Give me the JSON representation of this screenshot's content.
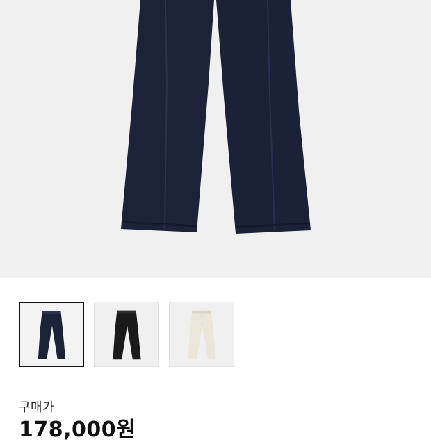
{
  "product": {
    "colors": {
      "navy": "#1c2238",
      "black": "#1a1a1a",
      "ivory": "#ece6da",
      "background": "#f0f0f0"
    },
    "thumbnails": [
      {
        "color_name": "navy",
        "selected": true
      },
      {
        "color_name": "black",
        "selected": false
      },
      {
        "color_name": "ivory",
        "selected": false
      }
    ]
  },
  "purchase": {
    "price_label": "구매가",
    "price_value": "178,000원"
  }
}
